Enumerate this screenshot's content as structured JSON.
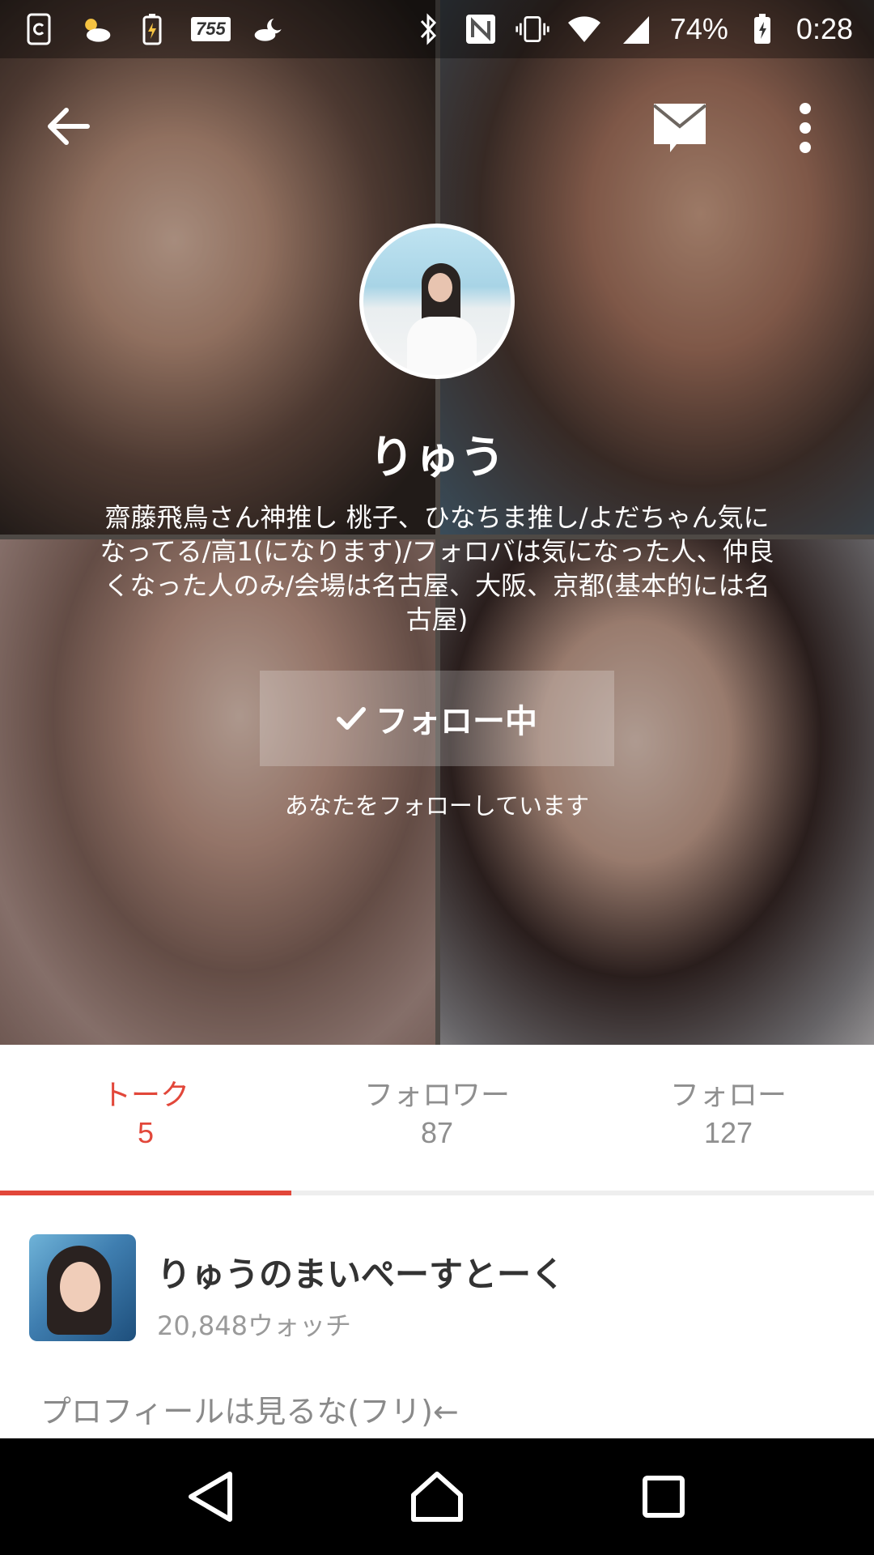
{
  "status_bar": {
    "badge": "755",
    "battery": "74%",
    "time": "0:28"
  },
  "app_bar": {
    "back_icon": "arrow-left-icon",
    "mail_icon": "mail-icon",
    "more_icon": "more-vert-icon"
  },
  "profile": {
    "username": "りゅう",
    "bio": "齋藤飛鳥さん神推し 桃子、ひなちま推し/よだちゃん気になってる/高1(になります)/フォロバは気になった人、仲良くなった人のみ/会場は名古屋、大阪、京都(基本的には名古屋)",
    "follow_button": "フォロー中",
    "follows_you": "あなたをフォローしています"
  },
  "tabs": [
    {
      "label": "トーク",
      "count": "5"
    },
    {
      "label": "フォロワー",
      "count": "87"
    },
    {
      "label": "フォロー",
      "count": "127"
    }
  ],
  "talks": [
    {
      "title": "りゅうのまいぺーすとーく",
      "watch": "20,848ウォッチ",
      "description": "プロフィールは見るな(フリ)←"
    }
  ],
  "colors": {
    "accent": "#e2473a",
    "navbar": "#000000"
  }
}
